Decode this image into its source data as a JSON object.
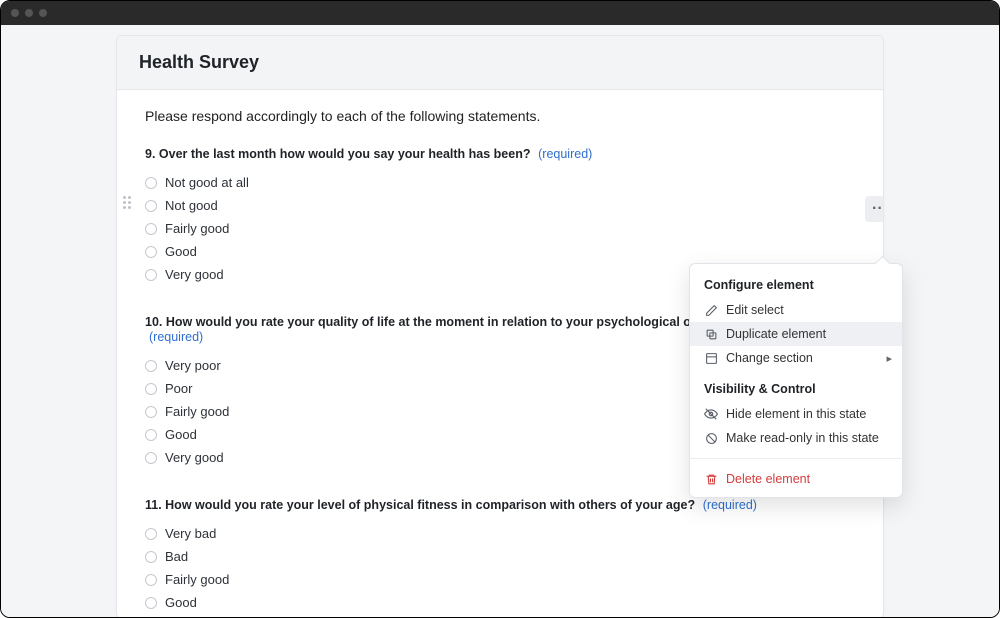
{
  "page": {
    "title": "Health Survey",
    "intro": "Please respond accordingly to each of the following statements."
  },
  "required_label": "(required)",
  "questions": [
    {
      "number": "9",
      "text": "Over the last month how would you say your health has been?",
      "required": true,
      "has_drag_handle": true,
      "has_ellipsis": true,
      "options": [
        "Not good at all",
        "Not good",
        "Fairly good",
        "Good",
        "Very good"
      ]
    },
    {
      "number": "10",
      "text": "How would you rate your quality of life at the moment in relation to your psychological or emotional well-being?",
      "required": true,
      "has_drag_handle": false,
      "has_ellipsis": false,
      "options": [
        "Very poor",
        "Poor",
        "Fairly good",
        "Good",
        "Very good"
      ]
    },
    {
      "number": "11",
      "text": "How would you rate your level of physical fitness in comparison with others of your age?",
      "required": true,
      "has_drag_handle": false,
      "has_ellipsis": false,
      "options": [
        "Very bad",
        "Bad",
        "Fairly good",
        "Good"
      ]
    }
  ],
  "context_menu": {
    "section1": {
      "title": "Configure element",
      "items": [
        {
          "id": "edit",
          "label": "Edit select",
          "icon": "pencil-icon",
          "highlighted": false,
          "submenu": false
        },
        {
          "id": "duplicate",
          "label": "Duplicate element",
          "icon": "duplicate-icon",
          "highlighted": true,
          "submenu": false
        },
        {
          "id": "change-section",
          "label": "Change section",
          "icon": "section-icon",
          "highlighted": false,
          "submenu": true
        }
      ]
    },
    "section2": {
      "title": "Visibility & Control",
      "items": [
        {
          "id": "hide",
          "label": "Hide element in this state",
          "icon": "eye-off-icon",
          "highlighted": false,
          "submenu": false
        },
        {
          "id": "readonly",
          "label": "Make read-only in this state",
          "icon": "block-icon",
          "highlighted": false,
          "submenu": false
        }
      ]
    },
    "danger": {
      "items": [
        {
          "id": "delete",
          "label": "Delete element",
          "icon": "trash-icon"
        }
      ]
    }
  }
}
